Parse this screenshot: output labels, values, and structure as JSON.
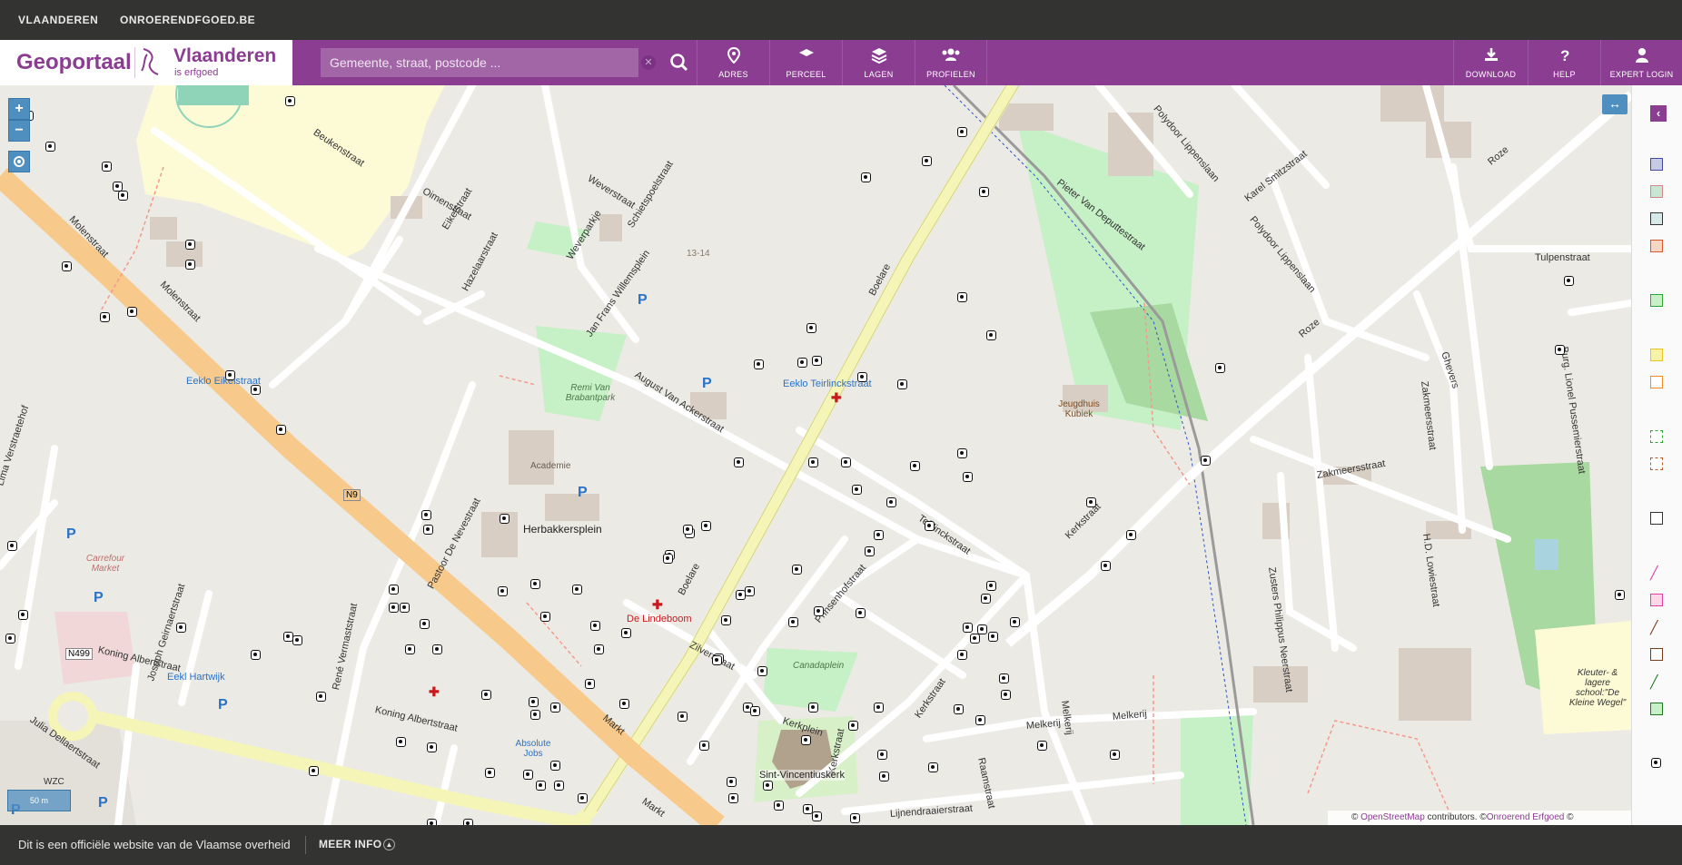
{
  "topbar": {
    "vlaanderen": "VLAANDEREN",
    "onroerend": "ONROERENDFGOED.BE"
  },
  "brand": {
    "geoportaal": "Geoportaal",
    "vlaanderen": "Vlaanderen",
    "tagline": "is erfgoed"
  },
  "search": {
    "placeholder": "Gemeente, straat, postcode ..."
  },
  "nav": {
    "adres": "ADRES",
    "perceel": "PERCEEL",
    "lagen": "LAGEN",
    "profielen": "PROFIELEN",
    "download": "DOWNLOAD",
    "help": "HELP",
    "expert": "EXPERT LOGIN"
  },
  "map": {
    "zoom_in": "+",
    "zoom_out": "−",
    "scale": "50 m",
    "streets": [
      "Beukenstraat",
      "Eikelstraat",
      "Oimenstraat",
      "Molenstraat",
      "Weverstraat",
      "Schietspoelstraat",
      "Hazelaarstraat",
      "Weverparkje",
      "Jan Frans Willemsplein",
      "August Van Ackerstraat",
      "Boelare",
      "Pieter Van Deputtestraat",
      "Polydoor Lippenslaan",
      "Karel Smitzstraat",
      "Roze",
      "Tulpenstraat",
      "Ghevers",
      "Zakmeersstraat",
      "Burg. Lionel Pussemierstraat",
      "H.D. Lowiestraat",
      "Zusters Philippus Neerstraat",
      "Kerkstraat",
      "Teirlinckstraat",
      "Prinsenhofstraat",
      "Zilverstraat",
      "Pastoor De Nevestraat",
      "René Vermaststraat",
      "Koning Albertstraat",
      "Joseph Geirnaertstraat",
      "Julia Dellaertstraat",
      "Lima Verstraetehof",
      "Markt",
      "Kerkplein",
      "Melkerij",
      "Raamstraat",
      "Lijnendraaierstraat"
    ],
    "pois": {
      "eekloEikelstraat": "Eeklo Eikelstraat",
      "eekloTeirlinck": "Eeklo Teirlinckstraat",
      "eekloHartwijk": "Eekl Hartwijk",
      "remi": "Remi Van Brabantpark",
      "academie": "Academie",
      "herbakker": "Herbakkersplein",
      "lindeboom": "De Lindeboom",
      "canada": "Canadaplein",
      "vincentius": "Sint-Vincentiuskerk",
      "jeugdhuis": "Jeugdhuis Kubiek",
      "carrefour": "Carrefour Market",
      "absolute": "Absolute Jobs",
      "school": "Kleuter- & lagere school:\"De Kleine Wegel\"",
      "wzc": "WZC",
      "n9": "N9",
      "n499": "N499",
      "number": "13-14"
    },
    "attribution": {
      "osm": "OpenStreetMap",
      "contrib": " contributors. ©",
      "oe": "Onroerend Erfgoed",
      "copy": " ©"
    }
  },
  "footer": {
    "notice": "Dit is een officiële website van de Vlaamse overheid",
    "more": "MEER INFO"
  },
  "colors": {
    "brand": "#8b3d92",
    "topbar": "#333332",
    "control": "#4f8fc0",
    "mainroad": "#f7c98b",
    "secondary": "#f5f5b8"
  }
}
